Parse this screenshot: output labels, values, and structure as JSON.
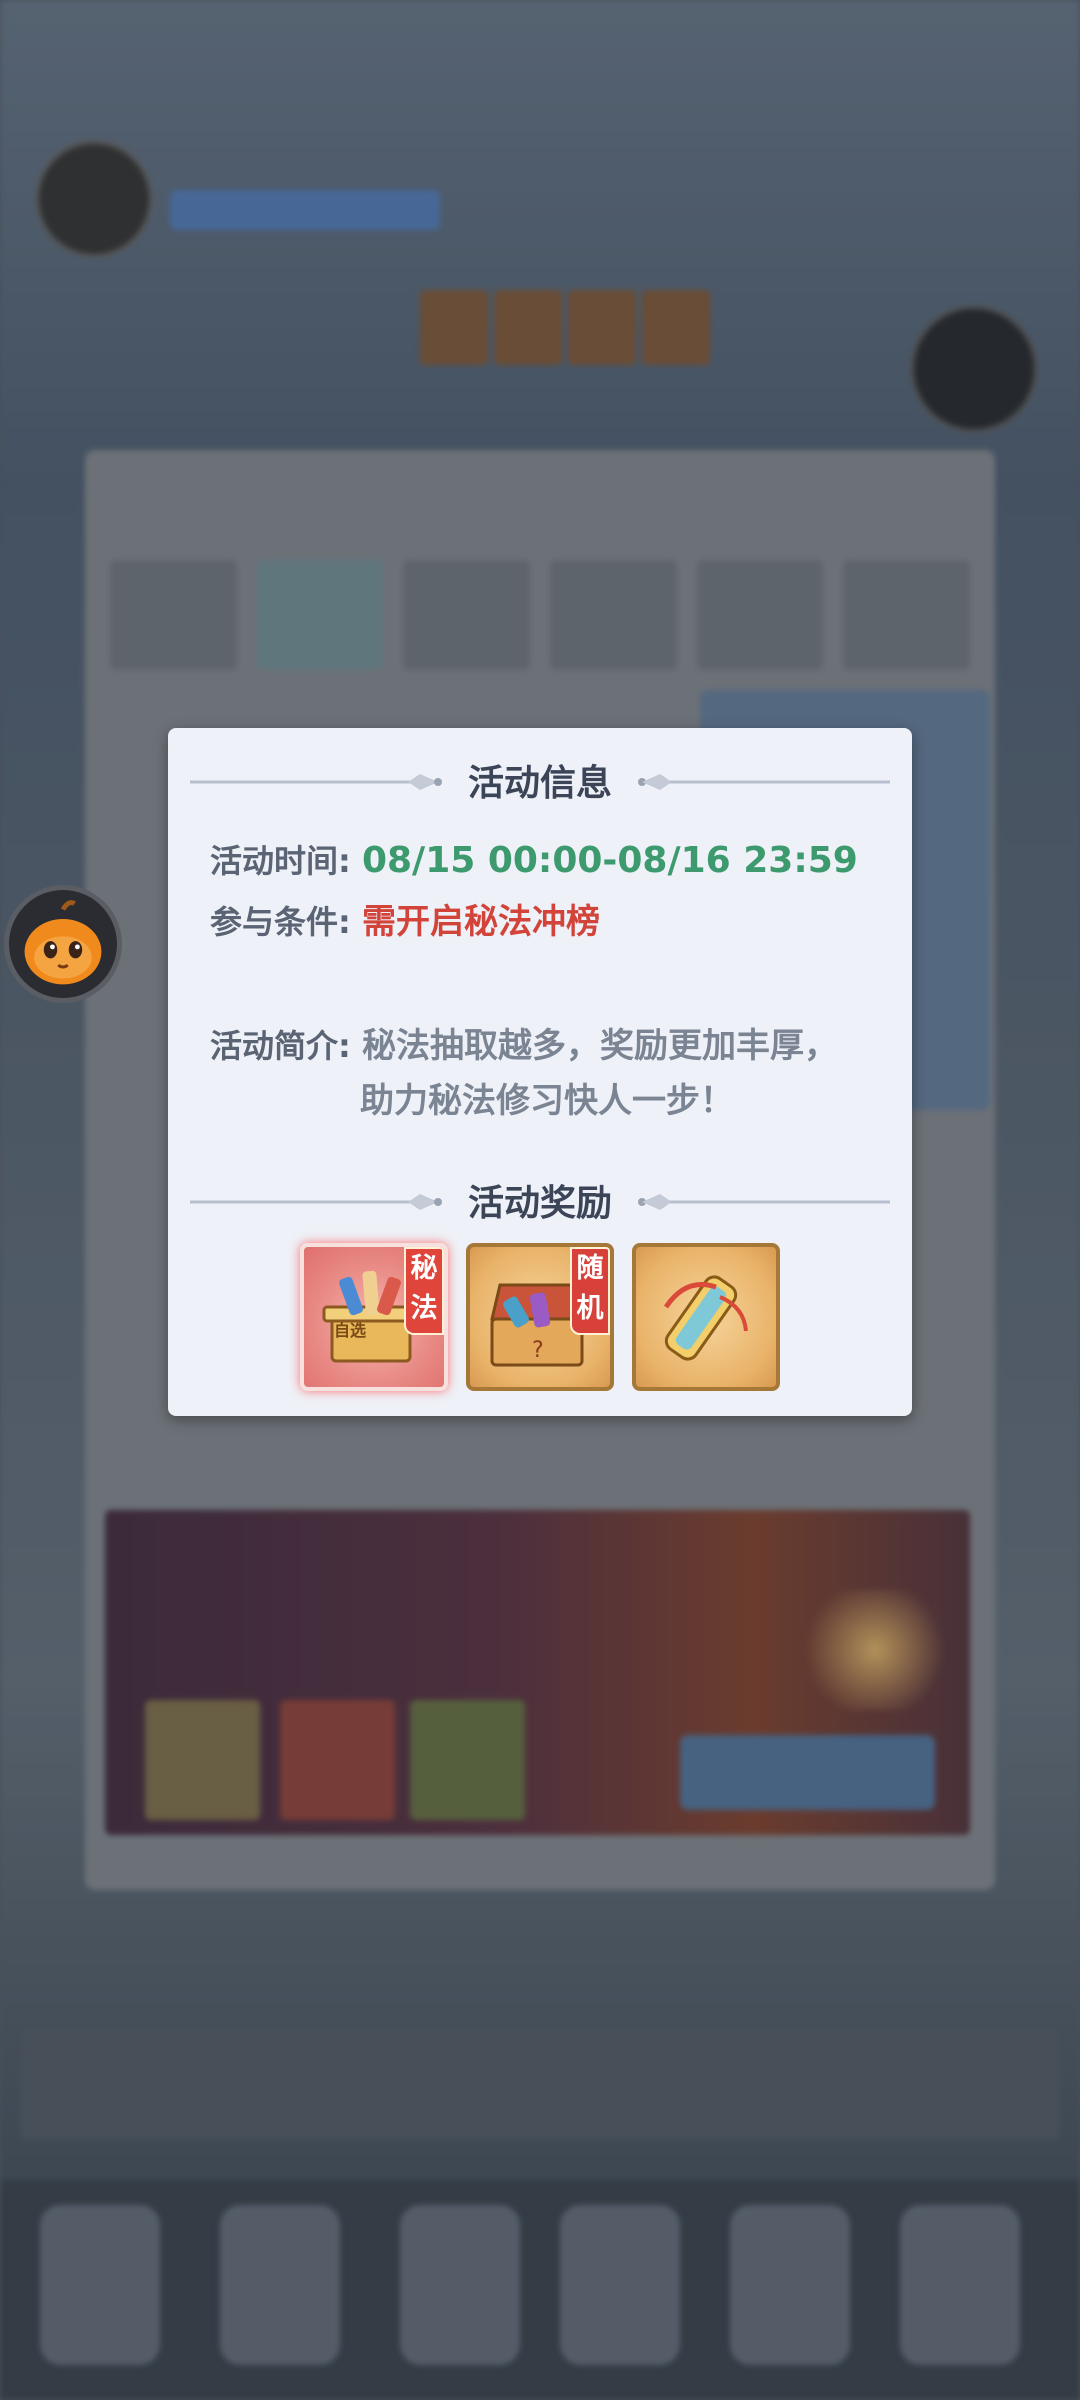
{
  "dialog": {
    "title": "活动信息",
    "time_label": "活动时间:",
    "time_value": "08/15 00:00-08/16 23:59",
    "condition_label": "参与条件:",
    "condition_value": "需开启秘法冲榜",
    "intro_label": "活动简介:",
    "intro_line1": "秘法抽取越多，奖励更加丰厚，",
    "intro_line2": "助力秘法修习快人一步！",
    "rewards_title": "活动奖励",
    "rewards": [
      {
        "tag1": "秘",
        "tag2": "法",
        "caption": "自选",
        "icon": "secret-art-chest-icon"
      },
      {
        "tag1": "随",
        "tag2": "机",
        "icon": "random-scroll-chest-icon"
      },
      {
        "icon": "scroll-icon"
      }
    ]
  },
  "colors": {
    "accent_green": "#3d9a6e",
    "accent_red": "#d2443a",
    "dialog_bg": "#eef1f7"
  }
}
